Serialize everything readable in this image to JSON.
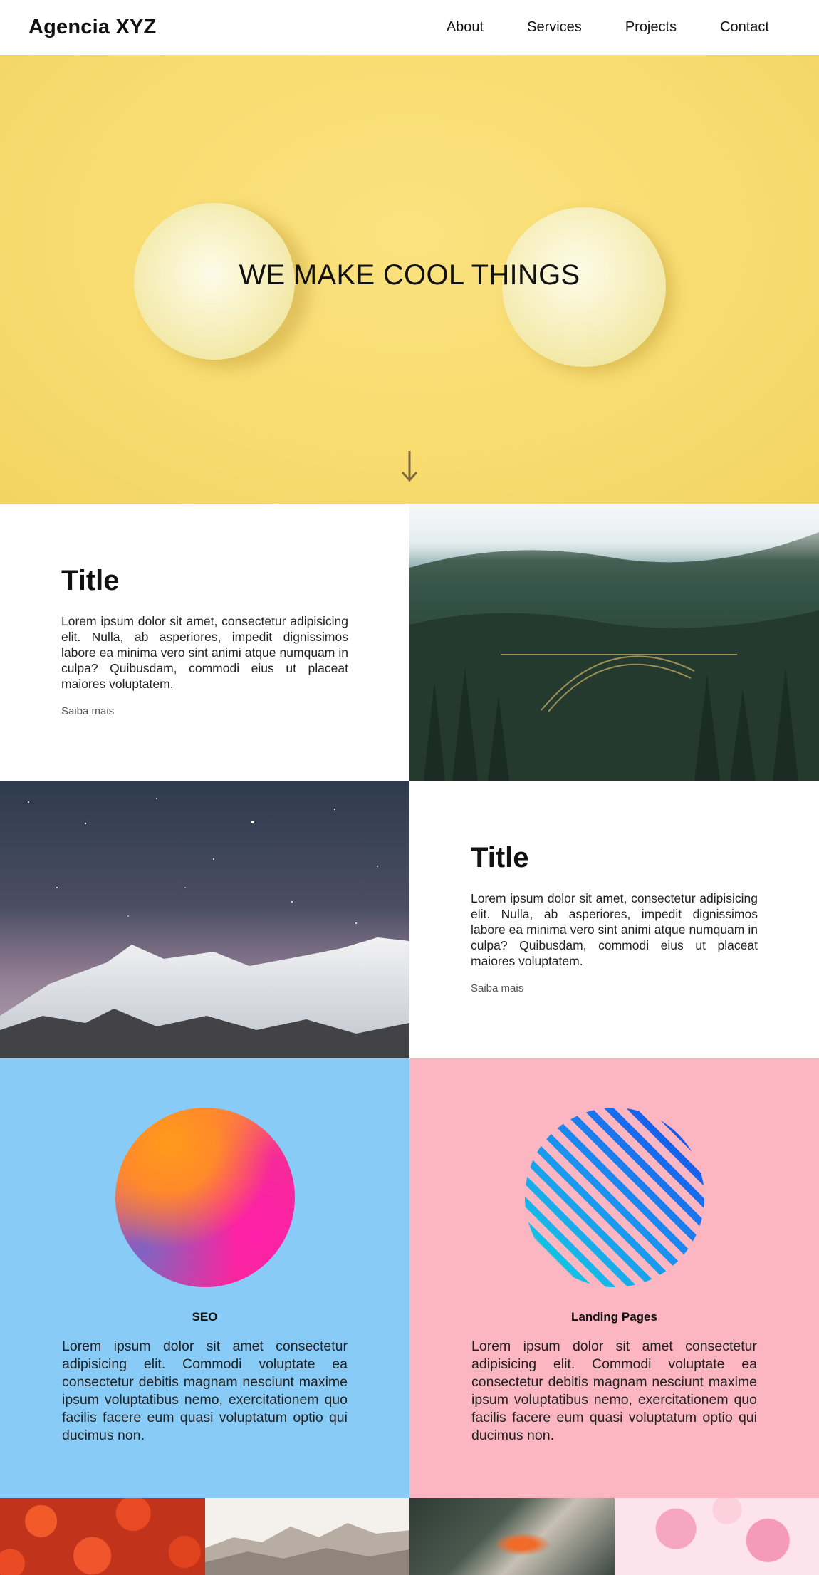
{
  "header": {
    "logo": "Agencia XYZ",
    "nav": [
      "About",
      "Services",
      "Projects",
      "Contact"
    ]
  },
  "hero": {
    "title": "WE MAKE COOL THINGS",
    "arrow_icon": "arrow-down-icon"
  },
  "features": [
    {
      "title": "Title",
      "body": "Lorem ipsum dolor sit amet, consectetur adipisicing elit. Nulla, ab asperiores, impedit dignissimos labore ea minima vero sint animi atque numquam in culpa? Quibusdam, commodi eius ut placeat maiores voluptatem.",
      "link": "Saiba mais"
    },
    {
      "title": "Title",
      "body": "Lorem ipsum dolor sit amet, consectetur adipisicing elit. Nulla, ab asperiores, impedit dignissimos labore ea minima vero sint animi atque numquam in culpa? Quibusdam, commodi eius ut placeat maiores voluptatem.",
      "link": "Saiba mais"
    }
  ],
  "services": [
    {
      "title": "SEO",
      "body": "Lorem ipsum dolor sit amet consectetur adipisicing elit. Commodi voluptate ea consectetur debitis magnam nesciunt maxime ipsum voluptatibus nemo, exercitationem quo facilis facere eum quasi voluptatum optio qui ducimus non."
    },
    {
      "title": "Landing Pages",
      "body": "Lorem ipsum dolor sit amet consectetur adipisicing elit. Commodi voluptate ea consectetur debitis magnam nesciunt maxime ipsum voluptatibus nemo, exercitationem quo facilis facere eum quasi voluptatum optio qui ducimus non."
    }
  ],
  "colors": {
    "hero_bg": "#f9dd74",
    "services_blue": "#89cbf7",
    "services_pink": "#fbb6c1"
  }
}
